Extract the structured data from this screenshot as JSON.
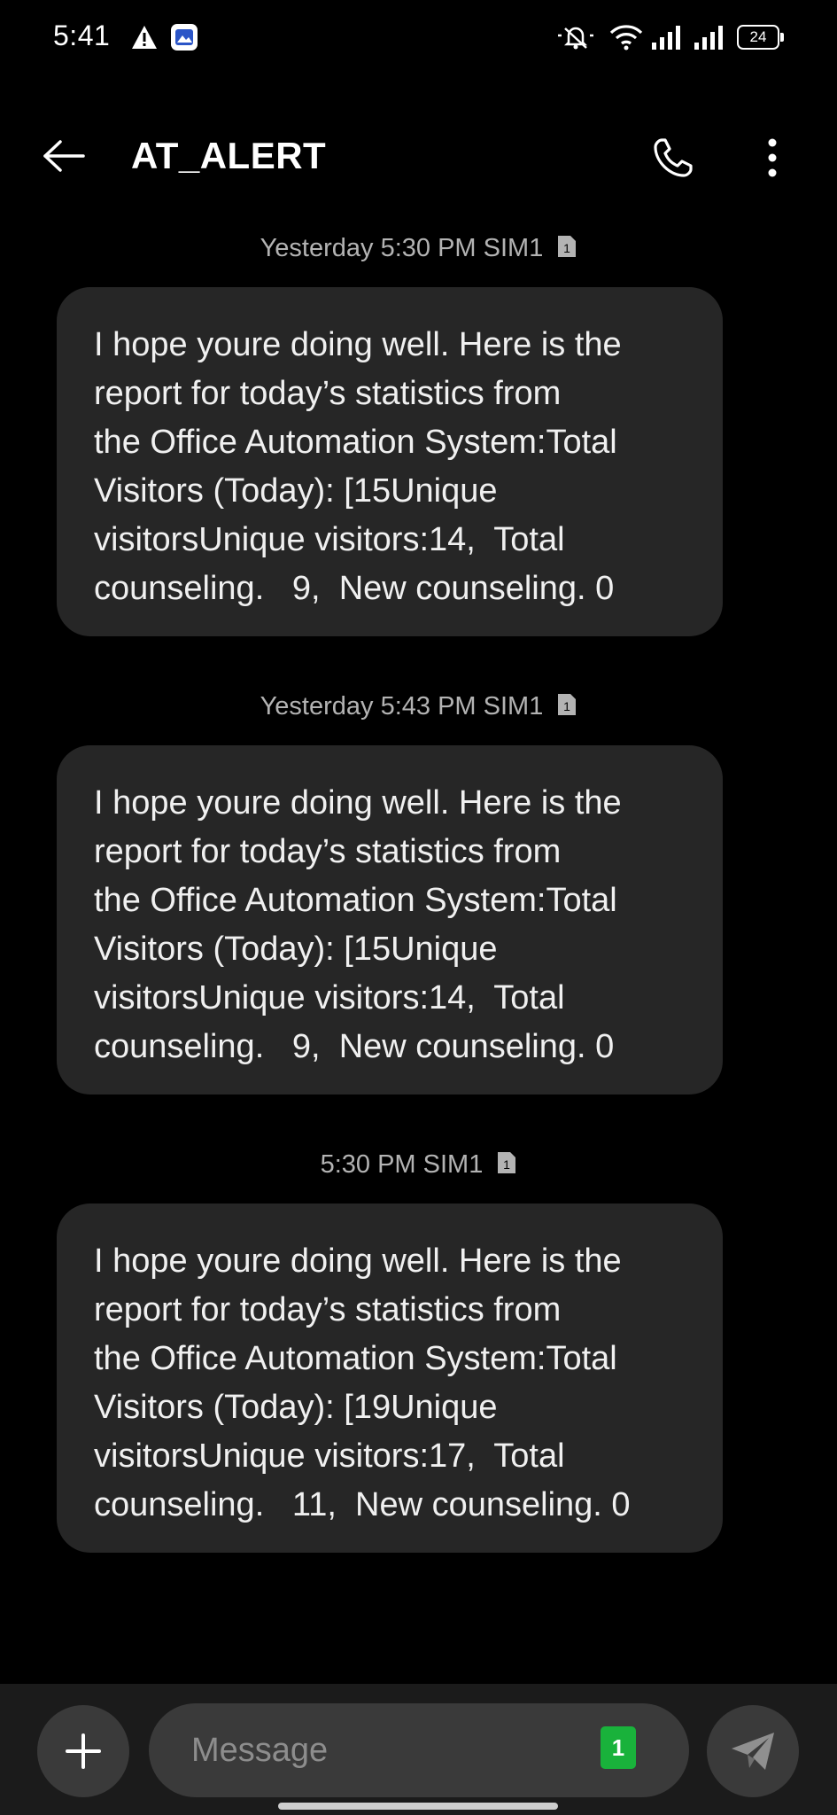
{
  "status_bar": {
    "time": "5:41",
    "battery_level": "24",
    "icons": [
      "warning-icon",
      "app-notification-icon",
      "mute-icon",
      "wifi-icon",
      "signal-icon",
      "signal-icon",
      "battery-icon"
    ]
  },
  "header": {
    "title": "AT_ALERT",
    "icons": [
      "back-arrow-icon",
      "phone-icon",
      "more-vert-icon"
    ]
  },
  "messages": [
    {
      "timestamp": "Yesterday 5:30 PM",
      "sim": "SIM1",
      "text": "I hope youre doing well. Here is the\nreport for today’s statistics from\nthe Office Automation System:Total\nVisitors (Today): [15Unique\nvisitorsUnique visitors:14,  Total\ncounseling.   9,  New counseling. 0"
    },
    {
      "timestamp": "Yesterday 5:43 PM",
      "sim": "SIM1",
      "text": "I hope youre doing well. Here is the\nreport for today’s statistics from\nthe Office Automation System:Total\nVisitors (Today): [15Unique\nvisitorsUnique visitors:14,  Total\ncounseling.   9,  New counseling. 0"
    },
    {
      "timestamp": "5:30 PM",
      "sim": "SIM1",
      "text": "I hope youre doing well. Here is the\nreport for today’s statistics from\nthe Office Automation System:Total\nVisitors (Today): [19Unique\nvisitorsUnique visitors:17,  Total\ncounseling.   11,  New counseling. 0"
    }
  ],
  "composer": {
    "placeholder": "Message",
    "sim_badge": "1",
    "icons": [
      "plus-icon",
      "send-icon"
    ]
  },
  "colors": {
    "background": "#000000",
    "bubble": "#262626",
    "sim_badge": "#19b23b",
    "timestamp_text": "#b3b3b3"
  }
}
